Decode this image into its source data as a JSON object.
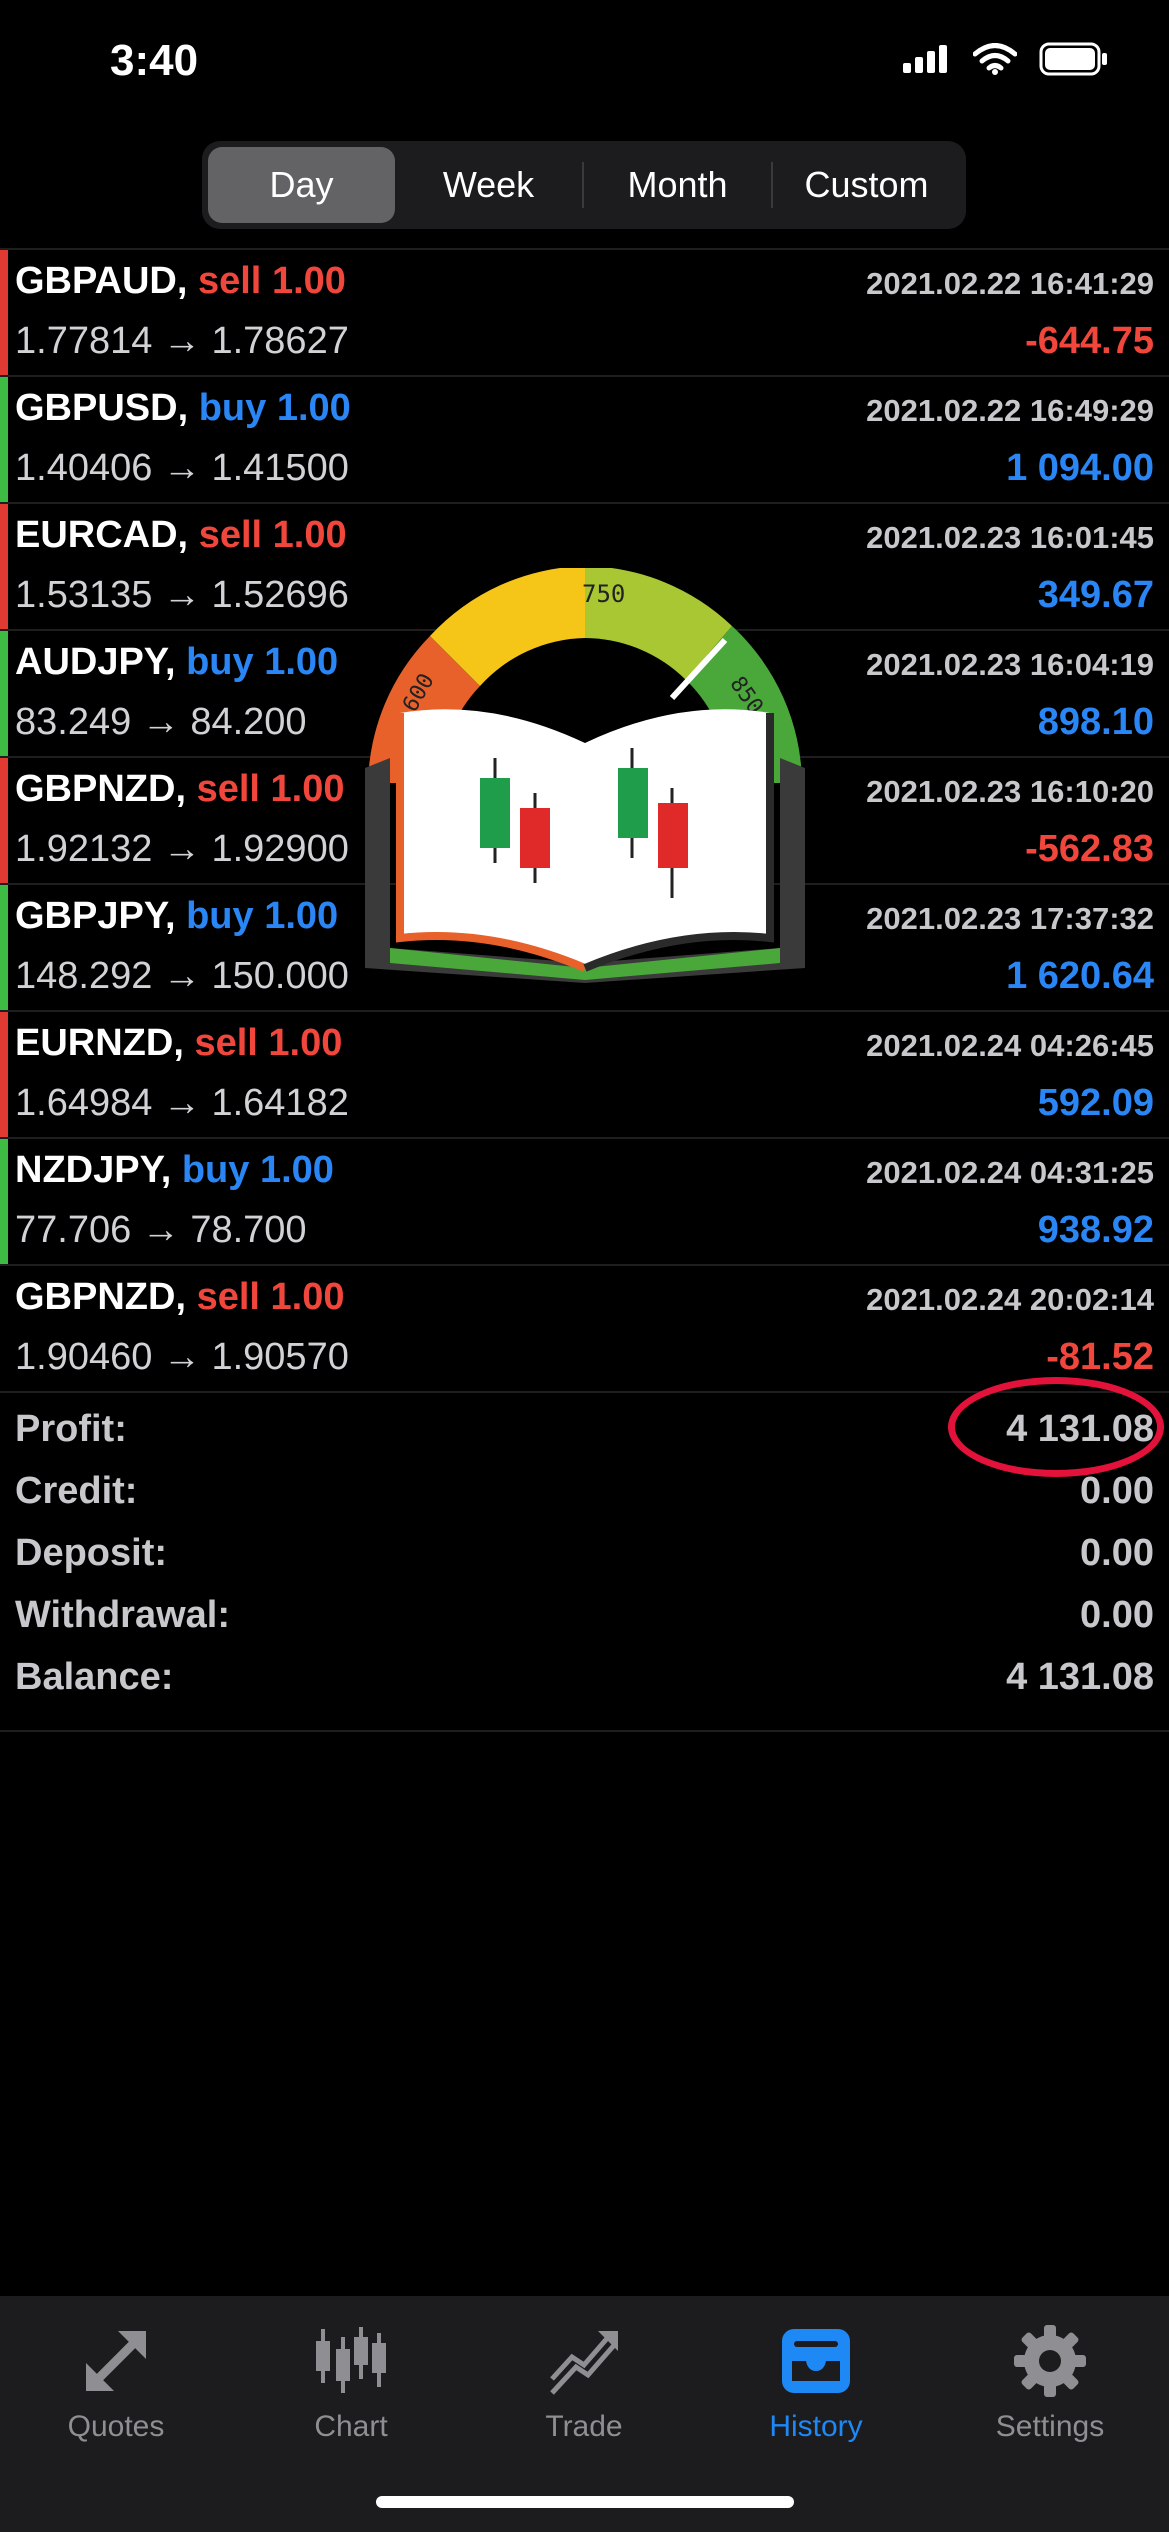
{
  "status_bar": {
    "time": "3:40"
  },
  "segments": [
    {
      "label": "Day",
      "active": true
    },
    {
      "label": "Week",
      "active": false
    },
    {
      "label": "Month",
      "active": false
    },
    {
      "label": "Custom",
      "active": false
    }
  ],
  "deals": [
    {
      "symbol": "GBPAUD,",
      "type": "sell",
      "volume": "1.00",
      "time": "2021.02.22 16:41:29",
      "prices": "1.77814 → 1.78627",
      "profit": "-644.75"
    },
    {
      "symbol": "GBPUSD,",
      "type": "buy",
      "volume": "1.00",
      "time": "2021.02.22 16:49:29",
      "prices": "1.40406 → 1.41500",
      "profit": "1 094.00"
    },
    {
      "symbol": "EURCAD,",
      "type": "sell",
      "volume": "1.00",
      "time": "2021.02.23 16:01:45",
      "prices": "1.53135 → 1.52696",
      "profit": "349.67"
    },
    {
      "symbol": "AUDJPY,",
      "type": "buy",
      "volume": "1.00",
      "time": "2021.02.23 16:04:19",
      "prices": "83.249 → 84.200",
      "profit": "898.10"
    },
    {
      "symbol": "GBPNZD,",
      "type": "sell",
      "volume": "1.00",
      "time": "2021.02.23 16:10:20",
      "prices": "1.92132 → 1.92900",
      "profit": "-562.83"
    },
    {
      "symbol": "GBPJPY,",
      "type": "buy",
      "volume": "1.00",
      "time": "2021.02.23 17:37:32",
      "prices": "148.292 → 150.000",
      "profit": "1 620.64"
    },
    {
      "symbol": "EURNZD,",
      "type": "sell",
      "volume": "1.00",
      "time": "2021.02.24 04:26:45",
      "prices": "1.64984 → 1.64182",
      "profit": "592.09"
    },
    {
      "symbol": "NZDJPY,",
      "type": "buy",
      "volume": "1.00",
      "time": "2021.02.24 04:31:25",
      "prices": "77.706 → 78.700",
      "profit": "938.92"
    },
    {
      "symbol": "GBPNZD,",
      "type": "sell",
      "volume": "1.00",
      "time": "2021.02.24 20:02:14",
      "prices": "1.90460 → 1.90570",
      "profit": "-81.52"
    }
  ],
  "summary": [
    {
      "label": "Profit:",
      "value": "4 131.08"
    },
    {
      "label": "Credit:",
      "value": "0.00"
    },
    {
      "label": "Deposit:",
      "value": "0.00"
    },
    {
      "label": "Withdrawal:",
      "value": "0.00"
    },
    {
      "label": "Balance:",
      "value": "4 131.08"
    }
  ],
  "logo": {
    "gauge_labels": [
      "600",
      "750",
      "850"
    ]
  },
  "tabs": [
    {
      "label": "Quotes",
      "icon": "quotes-arrows-icon",
      "active": false
    },
    {
      "label": "Chart",
      "icon": "candlestick-chart-icon",
      "active": false
    },
    {
      "label": "Trade",
      "icon": "trade-trend-icon",
      "active": false
    },
    {
      "label": "History",
      "icon": "history-inbox-icon",
      "active": true
    },
    {
      "label": "Settings",
      "icon": "gear-icon",
      "active": false
    }
  ],
  "colors": {
    "sell": "#f0463c",
    "buy": "#2a86f5",
    "active_tab": "#1e88f5",
    "highlight": "#e3123a"
  }
}
